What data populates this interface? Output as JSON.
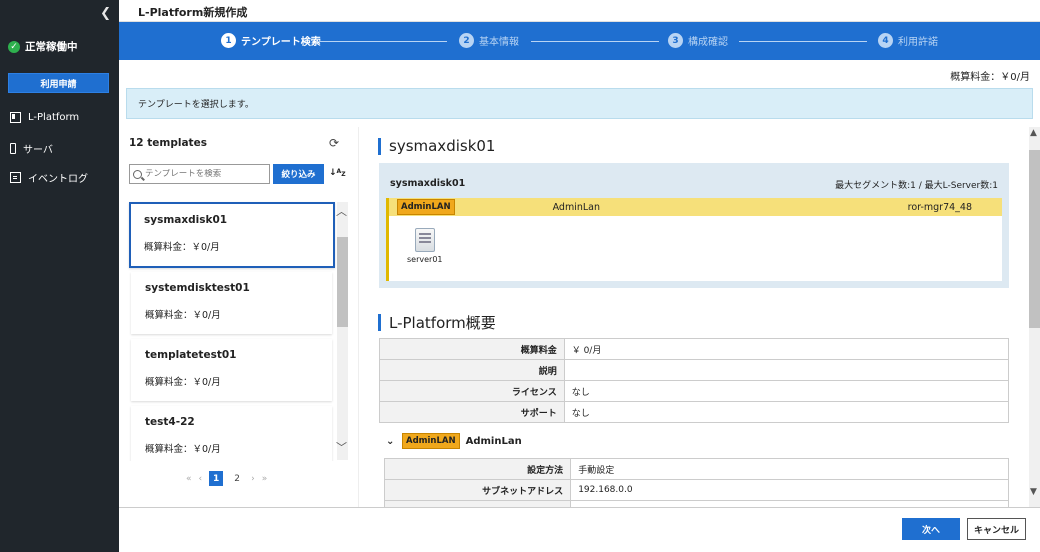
{
  "sidebar": {
    "collapse_icon": "chevron-left-icon",
    "status_label": "正常稼働中",
    "apply_button": "利用申請",
    "nav": [
      {
        "label": "L-Platform",
        "icon": "platform-icon"
      },
      {
        "label": "サーバ",
        "icon": "server-icon"
      },
      {
        "label": "イベントログ",
        "icon": "event-log-icon"
      }
    ]
  },
  "header": {
    "title": "L-Platform新規作成"
  },
  "steps": [
    {
      "num": "1",
      "label": "テンプレート検索",
      "active": true
    },
    {
      "num": "2",
      "label": "基本情報",
      "active": false
    },
    {
      "num": "3",
      "label": "構成確認",
      "active": false
    },
    {
      "num": "4",
      "label": "利用許諾",
      "active": false
    }
  ],
  "estimate": "概算料金：￥0/月",
  "info_message": "テンプレートを選択します。",
  "template_list": {
    "count_label": "12 templates",
    "search_placeholder": "テンプレートを検索",
    "filter_button": "絞り込み",
    "sort_label": "↓A Z",
    "items": [
      {
        "name": "sysmaxdisk01",
        "price": "概算料金：￥0/月",
        "selected": true
      },
      {
        "name": "systemdisktest01",
        "price": "概算料金：￥0/月",
        "selected": false
      },
      {
        "name": "templatetest01",
        "price": "概算料金：￥0/月",
        "selected": false
      },
      {
        "name": "test4-22",
        "price": "概算料金：￥0/月",
        "selected": false
      }
    ],
    "pager": {
      "first": "«",
      "prev": "‹",
      "pages": [
        "1",
        "2"
      ],
      "current": "1",
      "next": "›",
      "last": "»"
    }
  },
  "detail": {
    "template_title": "sysmaxdisk01",
    "topology": {
      "name": "sysmaxdisk01",
      "limits": "最大セグメント数:1 / 最大L-Server数:1",
      "segment": {
        "badge": "AdminLAN",
        "name": "AdminLan",
        "host": "ror-mgr74_48"
      },
      "server": {
        "label": "server01"
      }
    },
    "overview_title": "L-Platform概要",
    "overview": [
      {
        "key": "概算料金",
        "value": "￥ 0/月"
      },
      {
        "key": "説明",
        "value": ""
      },
      {
        "key": "ライセンス",
        "value": "なし"
      },
      {
        "key": "サポート",
        "value": "なし"
      }
    ],
    "adminlan": {
      "badge": "AdminLAN",
      "name": "AdminLan",
      "rows": [
        {
          "key": "設定方法",
          "value": "手動設定"
        },
        {
          "key": "サブネットアドレス",
          "value": "192.168.0.0"
        }
      ]
    }
  },
  "footer": {
    "next": "次へ",
    "cancel": "キャンセル"
  }
}
